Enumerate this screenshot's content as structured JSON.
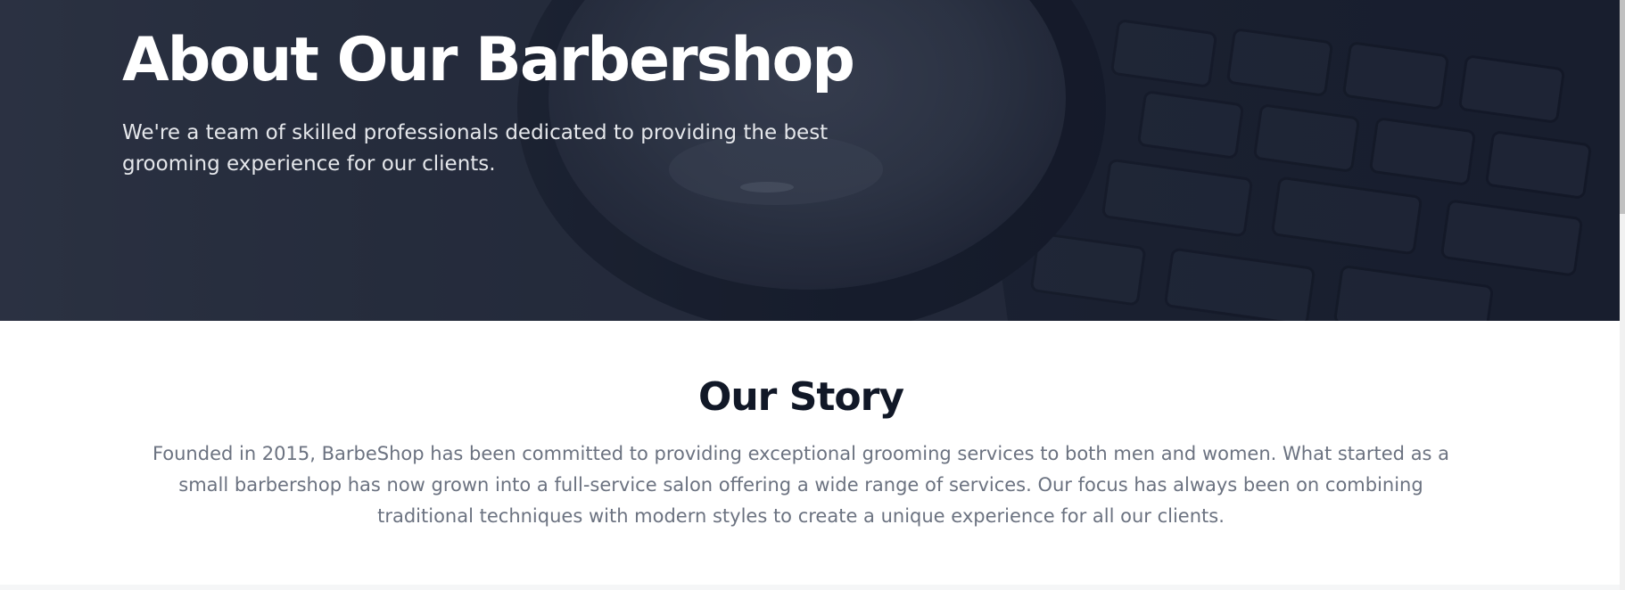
{
  "hero": {
    "title": "About Our Barbershop",
    "subtitle": "We're a team of skilled professionals dedicated to providing the best grooming experience for our clients.",
    "background_image": "magnifying-glass-over-keyboard",
    "overlay_color": "#111827"
  },
  "story": {
    "title": "Our Story",
    "text": "Founded in 2015, BarbeShop has been committed to providing exceptional grooming services to both men and women. What started as a small barbershop has now grown into a full-service salon offering a wide range of services. Our focus has always been on combining traditional techniques with modern styles to create a unique experience for all our clients."
  },
  "colors": {
    "heading_dark": "#111827",
    "body_gray": "#6b7280",
    "hero_text": "#ffffff"
  }
}
